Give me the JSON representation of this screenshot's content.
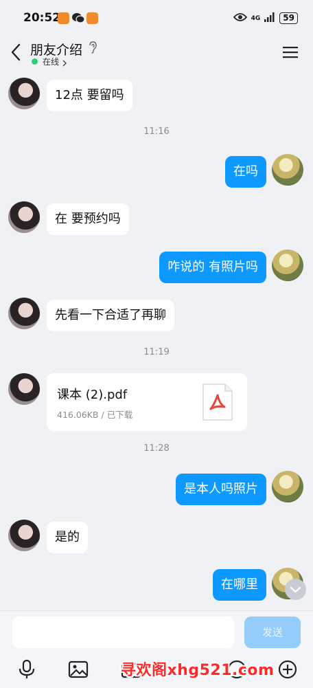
{
  "status_bar": {
    "time": "20:52",
    "network": "4G",
    "battery": "59"
  },
  "header": {
    "title": "朋友介绍",
    "online_status": "在线"
  },
  "messages": [
    {
      "side": "in",
      "text": "12点 要留吗"
    },
    {
      "type": "time",
      "text": "11:16"
    },
    {
      "side": "out",
      "text": "在吗"
    },
    {
      "side": "in",
      "text": "在 要预约吗"
    },
    {
      "side": "out",
      "text": "咋说的 有照片吗"
    },
    {
      "side": "in",
      "text": "先看一下合适了再聊"
    },
    {
      "type": "time",
      "text": "11:19"
    },
    {
      "side": "in",
      "type": "file",
      "file_name": "课本 (2).pdf",
      "file_size": "416.06KB",
      "file_status": "已下载"
    },
    {
      "type": "time",
      "text": "11:28"
    },
    {
      "side": "out",
      "text": "是本人吗照片"
    },
    {
      "side": "in",
      "text": "是的"
    },
    {
      "side": "out",
      "text": "在哪里"
    }
  ],
  "composer": {
    "placeholder": "",
    "send_label": "发送"
  },
  "toolbar_icons": [
    "microphone-icon",
    "image-icon",
    "camera-icon",
    "emoji-icon",
    "plus-icon"
  ],
  "watermark": "寻欢阁xhg521.com",
  "colors": {
    "outgoing_bubble": "#0d99ff",
    "incoming_bubble": "#ffffff",
    "background": "#f0f1f5",
    "online": "#2fcf6f",
    "send_button": "#94cdfb"
  }
}
